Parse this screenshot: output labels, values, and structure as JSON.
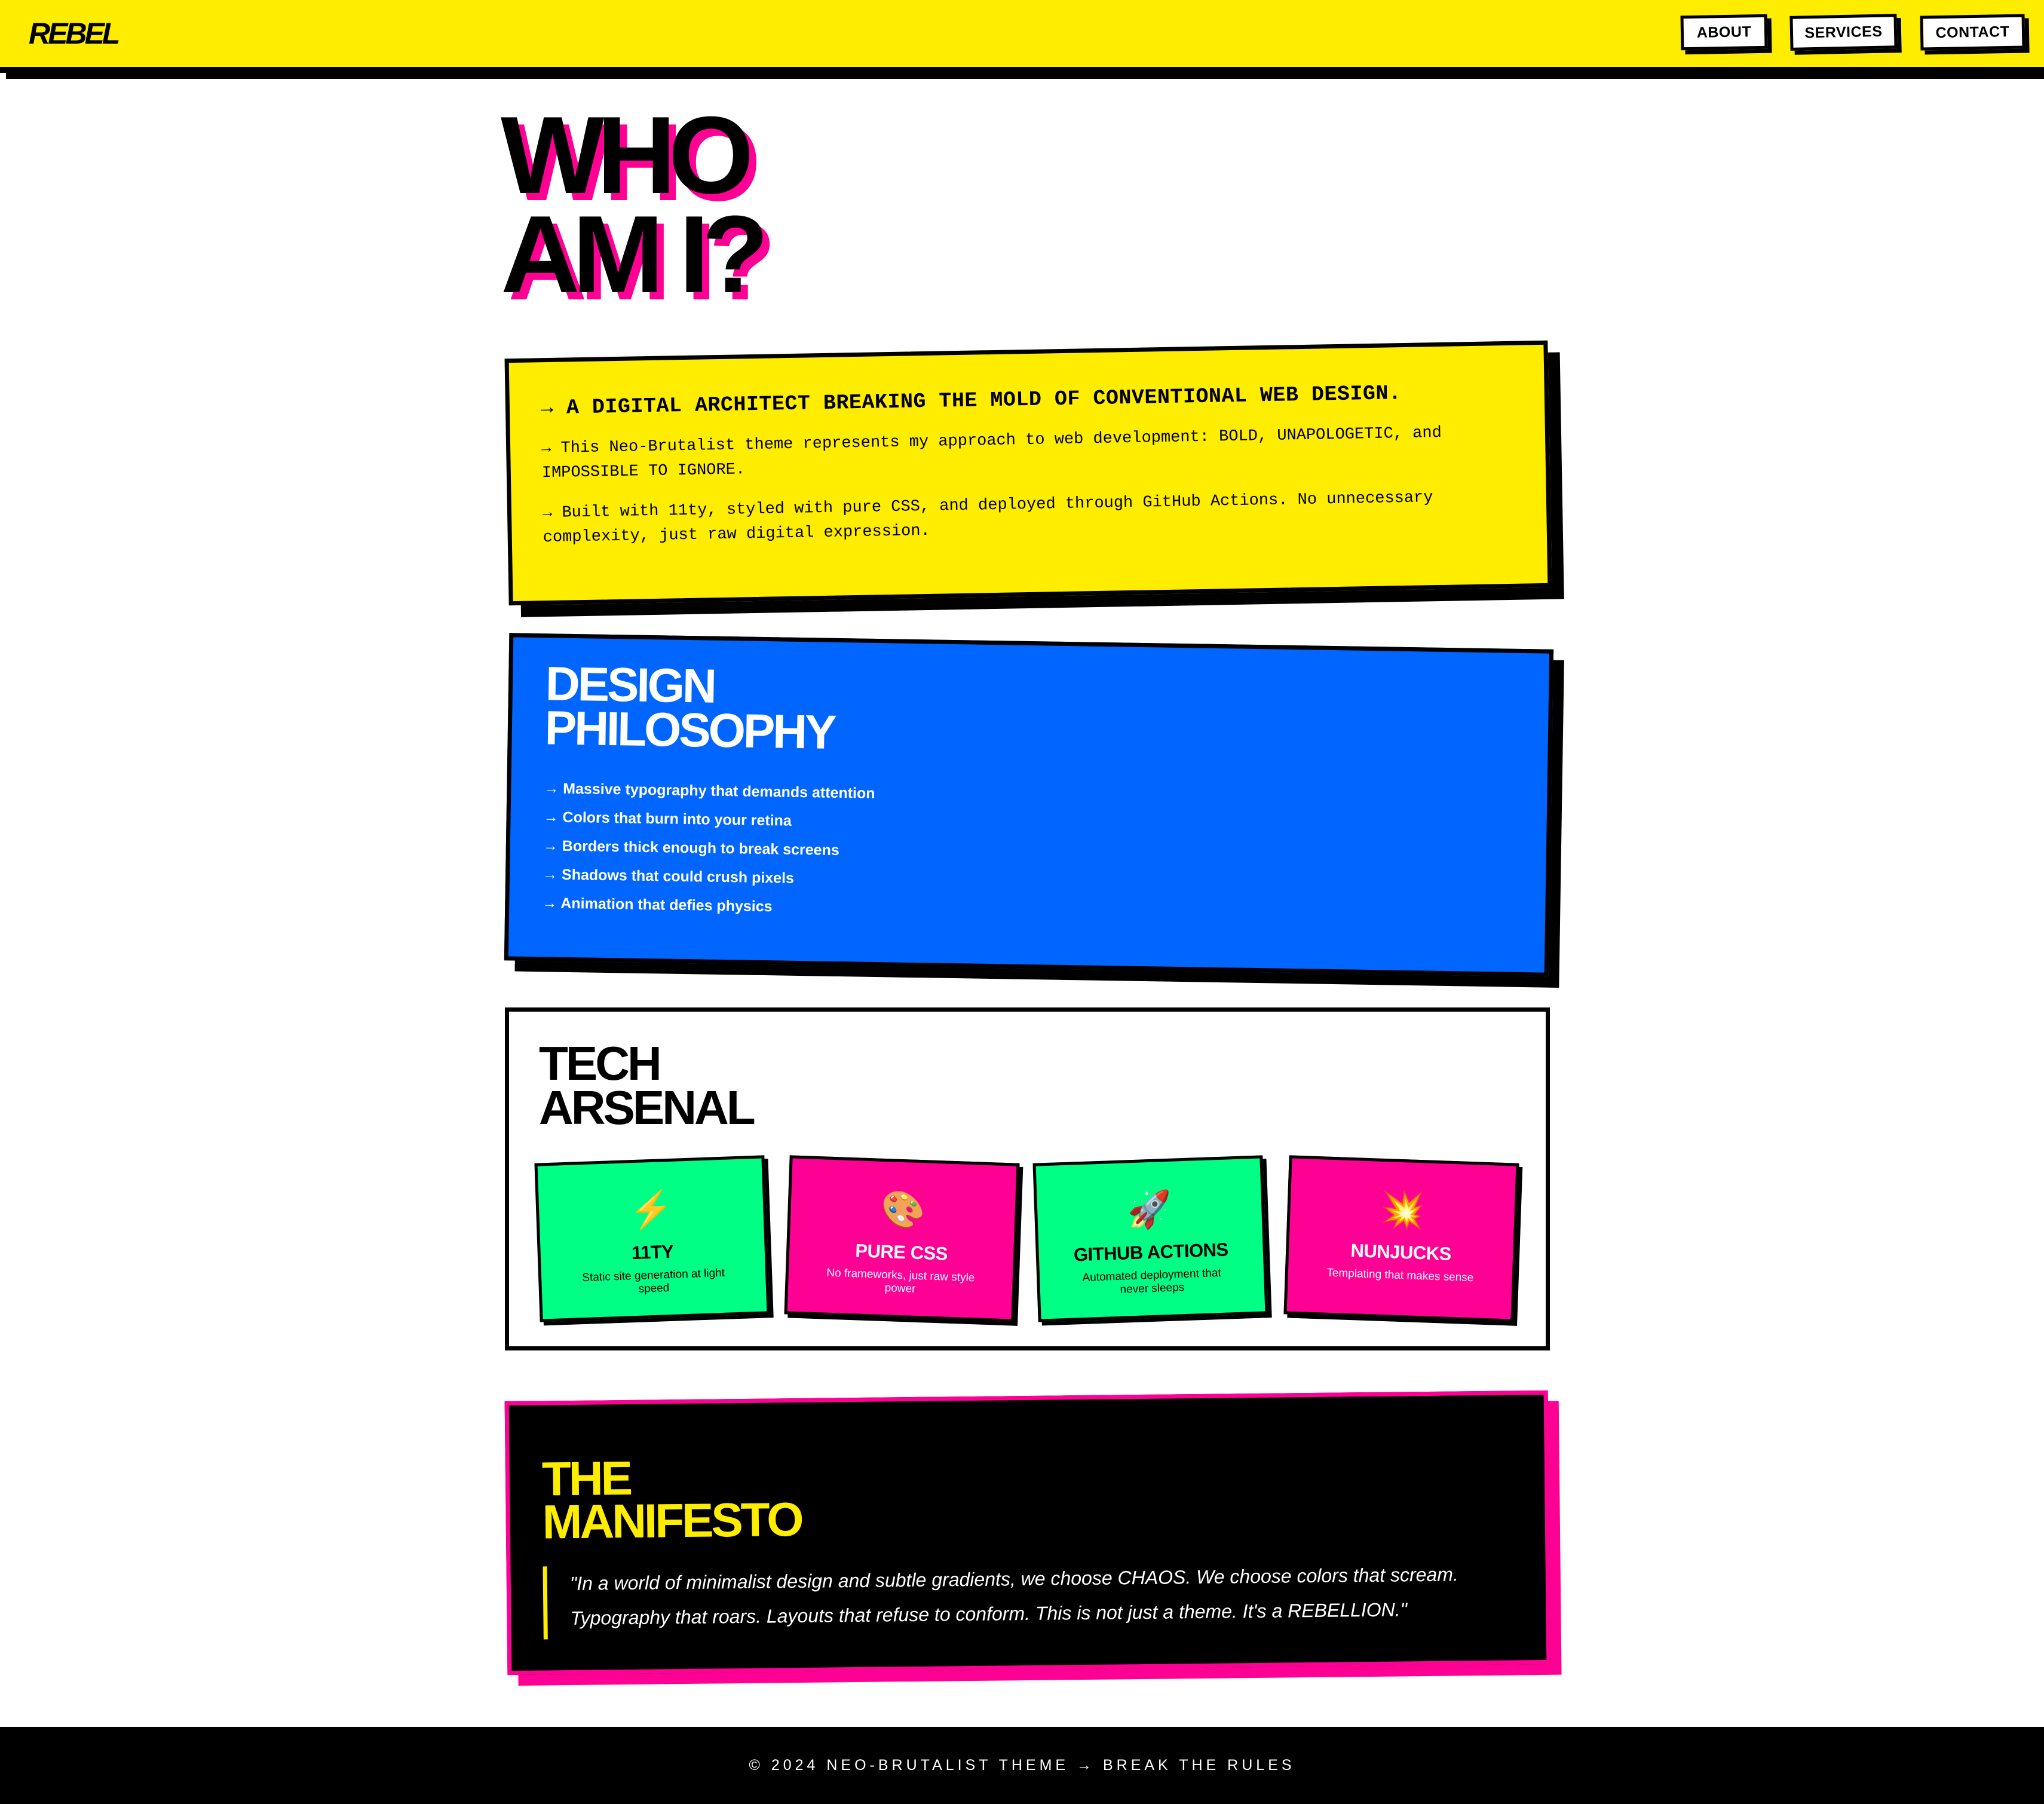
{
  "header": {
    "logo": "REBEL",
    "nav": [
      {
        "label": "ABOUT"
      },
      {
        "label": "SERVICES"
      },
      {
        "label": "CONTACT"
      }
    ]
  },
  "hero": {
    "line1": "WHO",
    "line2": "AM I?"
  },
  "intro": {
    "title": "→ A DIGITAL ARCHITECT BREAKING THE MOLD OF CONVENTIONAL WEB DESIGN.",
    "paragraphs": [
      "→ This Neo-Brutalist theme represents my approach to web development: BOLD, UNAPOLOGETIC, and IMPOSSIBLE TO IGNORE.",
      "→ Built with 11ty, styled with pure CSS, and deployed through GitHub Actions. No unnecessary complexity, just raw digital expression."
    ]
  },
  "philosophy": {
    "title_line1": "DESIGN",
    "title_line2": "PHILOSOPHY",
    "items": [
      "→ Massive typography that demands attention",
      "→ Colors that burn into your retina",
      "→ Borders thick enough to break screens",
      "→ Shadows that could crush pixels",
      "→ Animation that defies physics"
    ]
  },
  "arsenal": {
    "title_line1": "TECH",
    "title_line2": "ARSENAL",
    "items": [
      {
        "icon": "⚡",
        "icon_name": "lightning-icon",
        "name": "11TY",
        "desc": "Static site generation at light speed",
        "color": "#00ff85"
      },
      {
        "icon": "🎨",
        "icon_name": "palette-icon",
        "name": "PURE CSS",
        "desc": "No frameworks, just raw style power",
        "color": "#ff0095"
      },
      {
        "icon": "🚀",
        "icon_name": "rocket-icon",
        "name": "GITHUB ACTIONS",
        "desc": "Automated deployment that never sleeps",
        "color": "#00ff85"
      },
      {
        "icon": "💥",
        "icon_name": "explosion-icon",
        "name": "NUNJUCKS",
        "desc": "Templating that makes sense",
        "color": "#ff0095"
      }
    ]
  },
  "manifesto": {
    "title_line1": "THE",
    "title_line2": "MANIFESTO",
    "quote": "\"In a world of minimalist design and subtle gradients, we choose CHAOS. We choose colors that scream. Typography that roars. Layouts that refuse to conform. This is not just a theme. It's a REBELLION.\""
  },
  "footer": {
    "text": "© 2024 NEO-BRUTALIST THEME → BREAK THE RULES"
  },
  "colors": {
    "yellow": "#ffed00",
    "blue": "#0066ff",
    "pink": "#ff0095",
    "green": "#00ff85",
    "black": "#000000"
  }
}
